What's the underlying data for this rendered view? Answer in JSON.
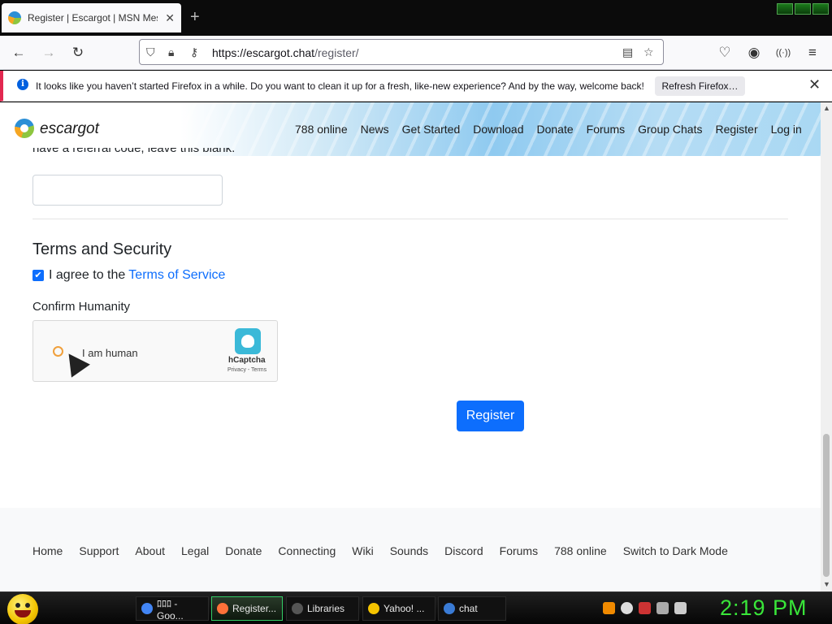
{
  "browser": {
    "tab_title": "Register | Escargot | MSN Mess",
    "tab_close": "✕",
    "new_tab": "+",
    "url_base": "https://escargot.chat",
    "url_path": "/register/"
  },
  "notification": {
    "message": "It looks like you haven’t started Firefox in a while. Do you want to clean it up for a fresh, like-new experience? And by the way, welcome back!",
    "button": "Refresh Firefox…",
    "info_glyph": "i",
    "close": "✕"
  },
  "site": {
    "brand": "escargot",
    "nav": [
      "788 online",
      "News",
      "Get Started",
      "Download",
      "Donate",
      "Forums",
      "Group Chats",
      "Register",
      "Log in"
    ]
  },
  "form": {
    "cut_text": "have a referral code, leave this blank.",
    "section_title": "Terms and Security",
    "agree_text": "I agree to the",
    "tos_link": "Terms of Service",
    "checkbox_glyph": "✔",
    "confirm_label": "Confirm Humanity",
    "captcha_text": "I am human",
    "captcha_brand": "hCaptcha",
    "captcha_links": "Privacy - Terms",
    "register_button": "Register"
  },
  "footer": {
    "links": [
      "Home",
      "Support",
      "About",
      "Legal",
      "Donate",
      "Connecting",
      "Wiki",
      "Sounds",
      "Discord",
      "Forums",
      "788 online",
      "Switch to Dark Mode"
    ]
  },
  "taskbar": {
    "tasks": [
      {
        "label": "ﾛﾛﾛ - Goo...",
        "icon_color": "#4285f4"
      },
      {
        "label": "Register...",
        "icon_color": "#ff7139"
      },
      {
        "label": "Libraries",
        "icon_color": "#555555"
      },
      {
        "label": "Yahoo! ...",
        "icon_color": "#f5c400"
      },
      {
        "label": "chat",
        "icon_color": "#3a7bd5"
      }
    ],
    "clock": "2:19 PM"
  },
  "colors": {
    "accent": "#0d6efd",
    "clock": "#39e639",
    "notice_border": "#e22850"
  }
}
